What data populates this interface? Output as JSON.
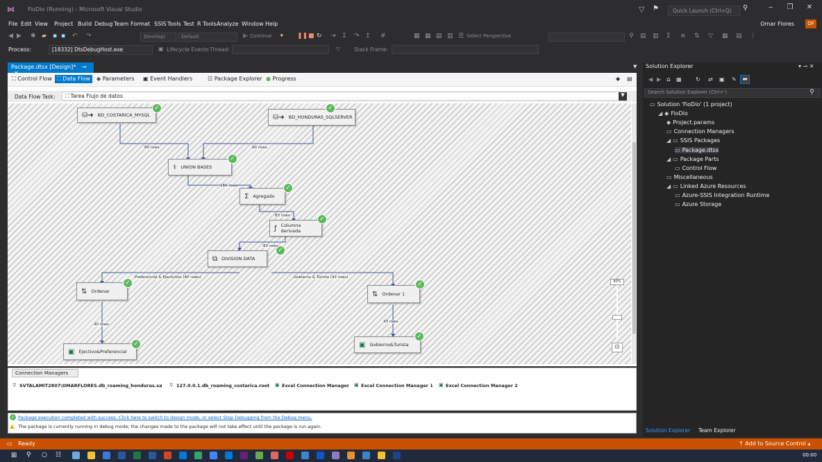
{
  "window": {
    "title": "FioDio (Running) - Microsoft Visual Studio",
    "quick_launch_placeholder": "Quick Launch (Ctrl+Q)",
    "user": "Omar Flores",
    "user_initials": "OF"
  },
  "menu": [
    "File",
    "Edit",
    "View",
    "Project",
    "Build",
    "Debug",
    "Team",
    "Format",
    "SSIS",
    "Tools",
    "Test",
    "R Tools",
    "Analyze",
    "Window",
    "Help"
  ],
  "toolbar": {
    "config": "Developi",
    "platform": "Default",
    "continue_label": "Continue",
    "perspective_placeholder": "Select Perspective",
    "process_label": "Process:",
    "process_value": "[18332] DtsDebugHost.exe",
    "lifecycle_label": "Lifecycle Events",
    "thread_label": "Thread:",
    "stack_frame_label": "Stack Frame:"
  },
  "doc_tab": {
    "label": "Package.dtsx [Design]*"
  },
  "design_tabs": [
    "Control Flow",
    "Data Flow",
    "Parameters",
    "Event Handlers",
    "Package Explorer",
    "Progress"
  ],
  "data_flow_task": {
    "label": "Data Flow Task:",
    "value": "Tarea Flujo de datos"
  },
  "nodes": {
    "bd_costarica": "BD_COSTARICA_MYSQL",
    "bd_honduras": "BD_HONDURAS_SQLSERVER",
    "union": "UNION BASES",
    "agregado": "Agregado",
    "columna": "Columna derivada",
    "division": "DIVISION DATA",
    "ordenar": "Ordenar",
    "ordenar1": "Ordenar 1",
    "ejectivo": "Ejectivo&Preferencial",
    "gobierno": "Gobierno&Turista"
  },
  "edges": {
    "cr_union": "80 rows",
    "hn_union": "80 rows",
    "union_agg": "160 rows",
    "agg_col": "83 rows",
    "col_div": "83 rows",
    "div_ord": "Preferencial & Ejectutivo (40 rows)",
    "div_ord1": "Gobierno & Turista (43 rows)",
    "ord_dest": "40 rows",
    "ord1_dest": "43 rows"
  },
  "zoom_level": "80%",
  "connection_managers": {
    "tab": "Connection Managers",
    "items": [
      "SVTALAMIT2807\\OMARFLORES.db_roaming_honduras.sa",
      "127.0.0.1.db_roaming_costarica.root",
      "Excel Connection Manager",
      "Excel Connection Manager 1",
      "Excel Connection Manager 2"
    ]
  },
  "messages": {
    "success": "Package execution completed with success. Click here to switch to design mode, or select Stop Debugging from the Debug menu.",
    "warning": "The package is currently running in debug mode; the changes made to the package will not take effect until the package is run again."
  },
  "solution_explorer": {
    "title": "Solution Explorer",
    "search_placeholder": "Search Solution Explorer (Ctrl+')",
    "tree": [
      {
        "label": "Solution 'FioDio' (1 project)",
        "level": 0
      },
      {
        "label": "FioDio",
        "level": 1
      },
      {
        "label": "Project.params",
        "level": 2
      },
      {
        "label": "Connection Managers",
        "level": 2
      },
      {
        "label": "SSIS Packages",
        "level": 2
      },
      {
        "label": "Package.dtsx",
        "level": 3
      },
      {
        "label": "Package Parts",
        "level": 2
      },
      {
        "label": "Control Flow",
        "level": 3
      },
      {
        "label": "Miscellaneous",
        "level": 2
      },
      {
        "label": "Linked Azure Resources",
        "level": 2
      },
      {
        "label": "Azure-SSIS Integration Runtime",
        "level": 3
      },
      {
        "label": "Azure Storage",
        "level": 3
      }
    ],
    "bottom_tabs": [
      "Solution Explorer",
      "Team Explorer"
    ]
  },
  "status": {
    "text": "Ready",
    "source_control": "Add to Source Control"
  },
  "taskbar": {
    "clock": "00:00"
  },
  "colors": {
    "accent": "#007acc",
    "status": "#ca5100",
    "check": "#5cb85c"
  }
}
